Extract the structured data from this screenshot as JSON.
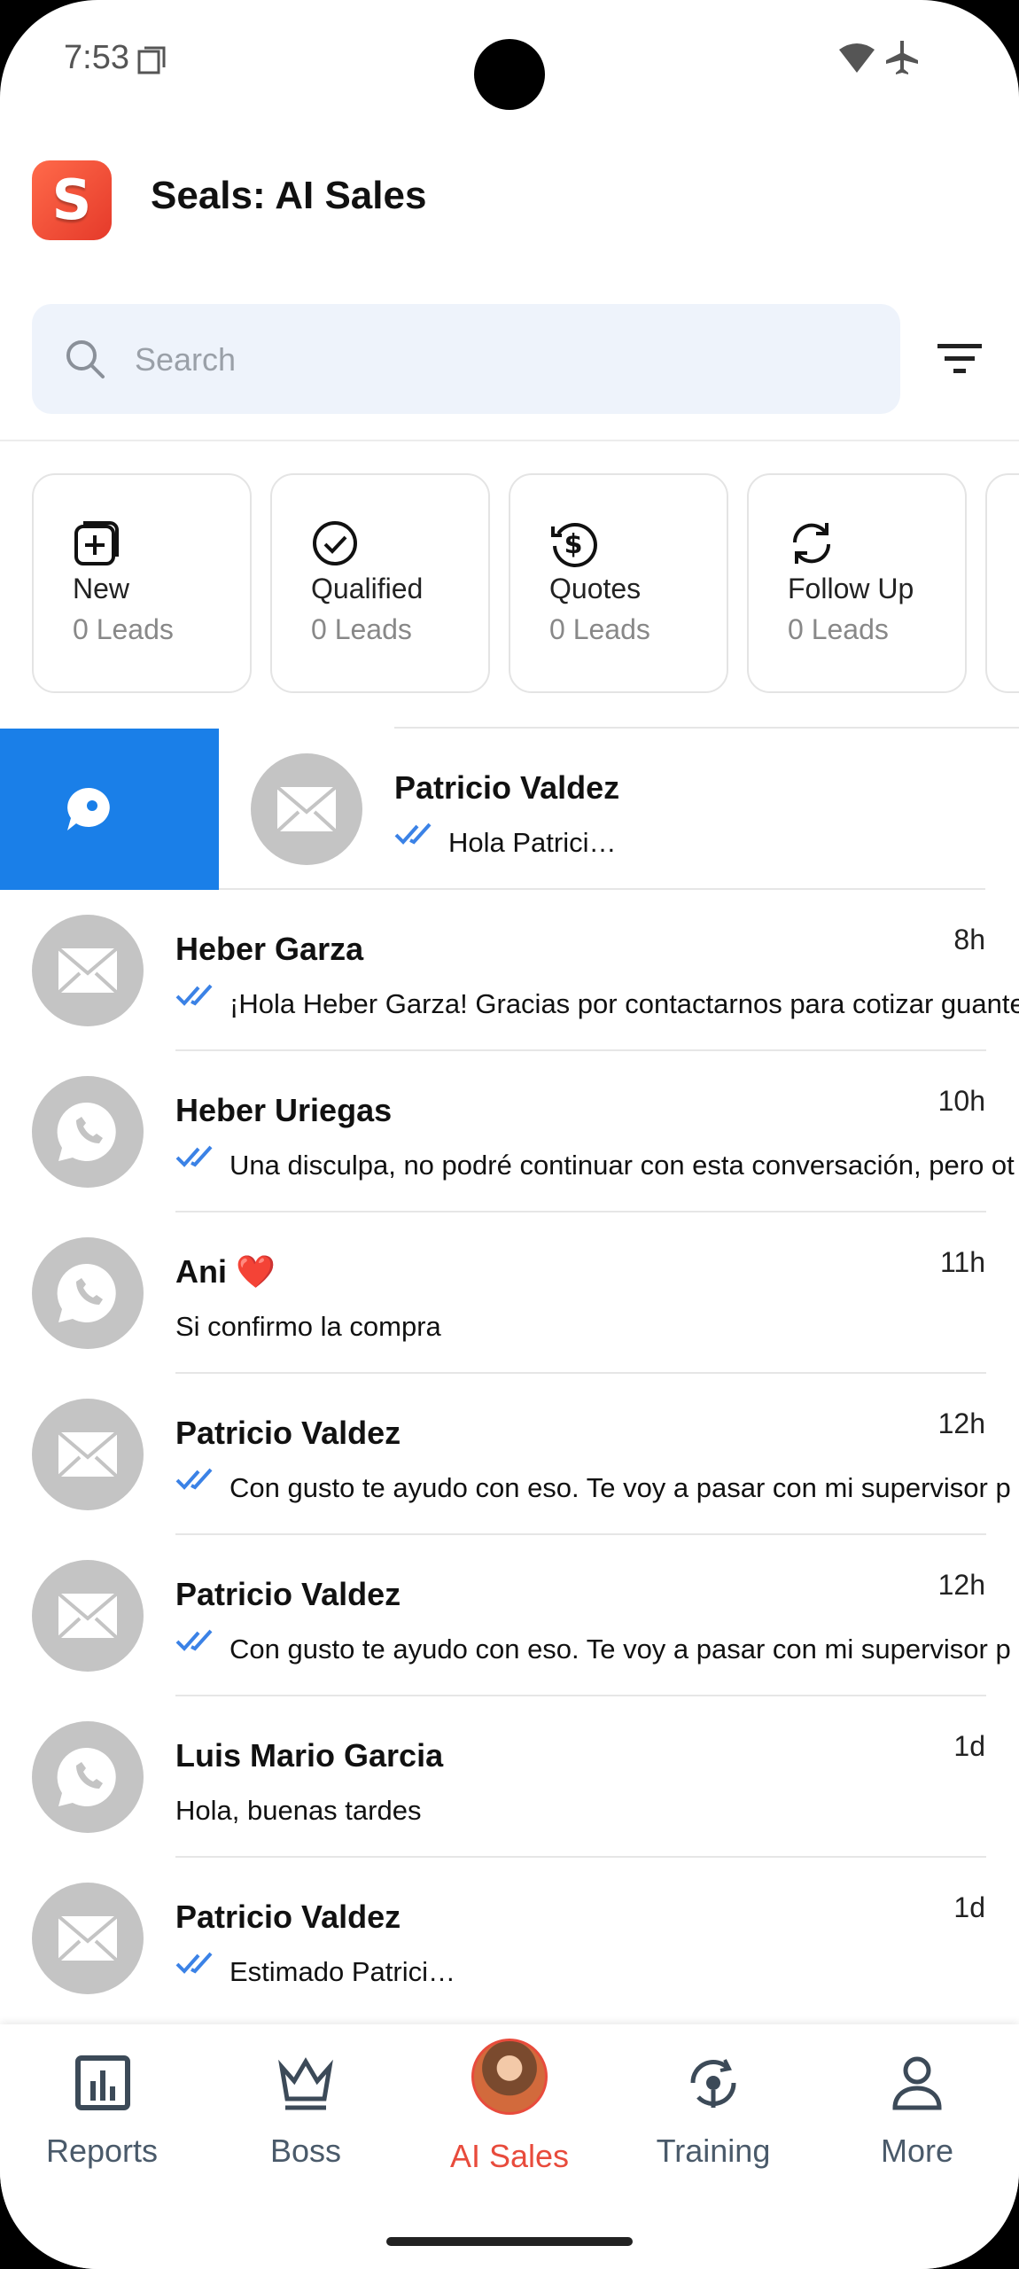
{
  "status_bar": {
    "time": "7:53"
  },
  "header": {
    "app_icon_letter": "S",
    "title": "Seals: AI Sales"
  },
  "search": {
    "placeholder": "Search"
  },
  "categories": [
    {
      "title": "New",
      "count": "0 Leads",
      "icon": "add-square-icon"
    },
    {
      "title": "Qualified",
      "count": "0 Leads",
      "icon": "check-circle-icon"
    },
    {
      "title": "Quotes",
      "count": "0 Leads",
      "icon": "dollar-refresh-icon"
    },
    {
      "title": "Follow Up",
      "count": "0 Leads",
      "icon": "sync-icon"
    }
  ],
  "conversations": [
    {
      "name": "Patricio Valdez",
      "time": "",
      "message": "Hola Patrici…",
      "channel": "email",
      "read_ticks": true
    },
    {
      "name": "Heber Garza",
      "time": "8h",
      "message": "¡Hola Heber Garza! Gracias por contactarnos para cotizar guantes",
      "channel": "email",
      "read_ticks": true
    },
    {
      "name": "Heber Uriegas",
      "time": "10h",
      "message": "Una disculpa, no podré continuar con esta conversación, pero ot",
      "channel": "whatsapp",
      "read_ticks": true
    },
    {
      "name": "Ani ❤️",
      "time": "11h",
      "message": "Si confirmo la compra",
      "channel": "whatsapp",
      "read_ticks": false
    },
    {
      "name": "Patricio Valdez",
      "time": "12h",
      "message": "Con gusto te ayudo con eso. Te voy a pasar con mi supervisor p",
      "channel": "email",
      "read_ticks": true
    },
    {
      "name": "Patricio Valdez",
      "time": "12h",
      "message": "Con gusto te ayudo con eso. Te voy a pasar con mi supervisor p",
      "channel": "email",
      "read_ticks": true
    },
    {
      "name": "Luis Mario Garcia",
      "time": "1d",
      "message": "Hola, buenas tardes",
      "channel": "whatsapp",
      "read_ticks": false
    },
    {
      "name": "Patricio Valdez",
      "time": "1d",
      "message": "Estimado Patrici…",
      "channel": "email",
      "read_ticks": true
    }
  ],
  "bottom_nav": [
    {
      "label": "Reports",
      "icon": "bar-chart-icon"
    },
    {
      "label": "Boss",
      "icon": "crown-icon"
    },
    {
      "label": "AI Sales",
      "icon": "ai-avatar",
      "active": true
    },
    {
      "label": "Training",
      "icon": "target-sync-icon"
    },
    {
      "label": "More",
      "icon": "person-icon"
    }
  ],
  "colors": {
    "accent": "#1a7fe8",
    "brand_red": "#e84b3c",
    "search_bg": "#eef3fb",
    "tick_blue": "#3b82e6"
  }
}
